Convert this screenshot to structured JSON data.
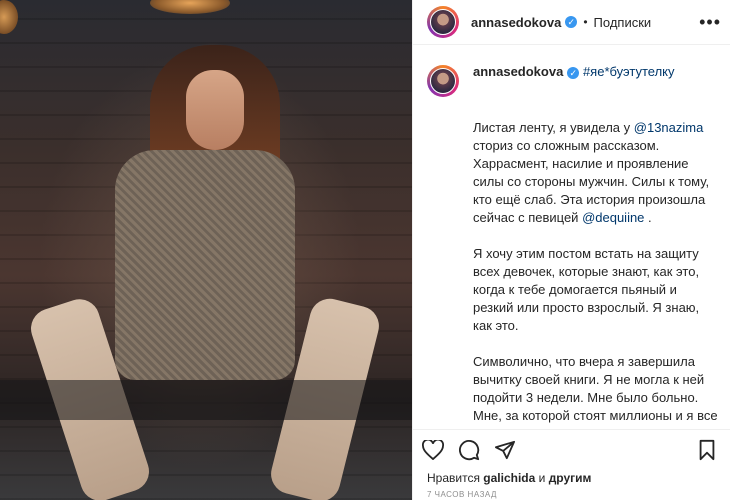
{
  "post": {
    "username": "annasedokova",
    "verified_mark": "✓",
    "separator": "•",
    "follow_label": "Подписки",
    "more_icon": "•••",
    "hashtag": "#яе*буэтутелку",
    "caption": {
      "p1_part1": "Листая ленту, я увидела у",
      "p1_mention1": "@13nazima",
      "p1_part2": " сториз со сложным рассказом. Харрасмент, насилие и проявление силы со стороны мужчин. Силы к тому, кто ещё слаб. Эта история произошла сейчас с певицей ",
      "p1_mention2": "@dequiine",
      "p1_end": " .",
      "p2": "Я хочу этим постом встать на защиту всех девочек, которые знают, как это, когда к тебе домогается пьяный и резкий или просто взрослый. Я знаю, как это.",
      "p3": "Символично, что вчера я завершила вычитку своей книги. Я не могла к ней подойти 3 недели. Мне было больно. Мне, за которой стоят миллионы и я все равно молчала и"
    },
    "likes_prefix": "Нравится ",
    "likes_user": "galichida",
    "likes_middle": " и ",
    "likes_others": "другим",
    "time_label": "7 ЧАСОВ НАЗАД"
  },
  "icons": {
    "like": "heart-icon",
    "comment": "comment-icon",
    "share": "share-icon",
    "save": "bookmark-icon"
  }
}
